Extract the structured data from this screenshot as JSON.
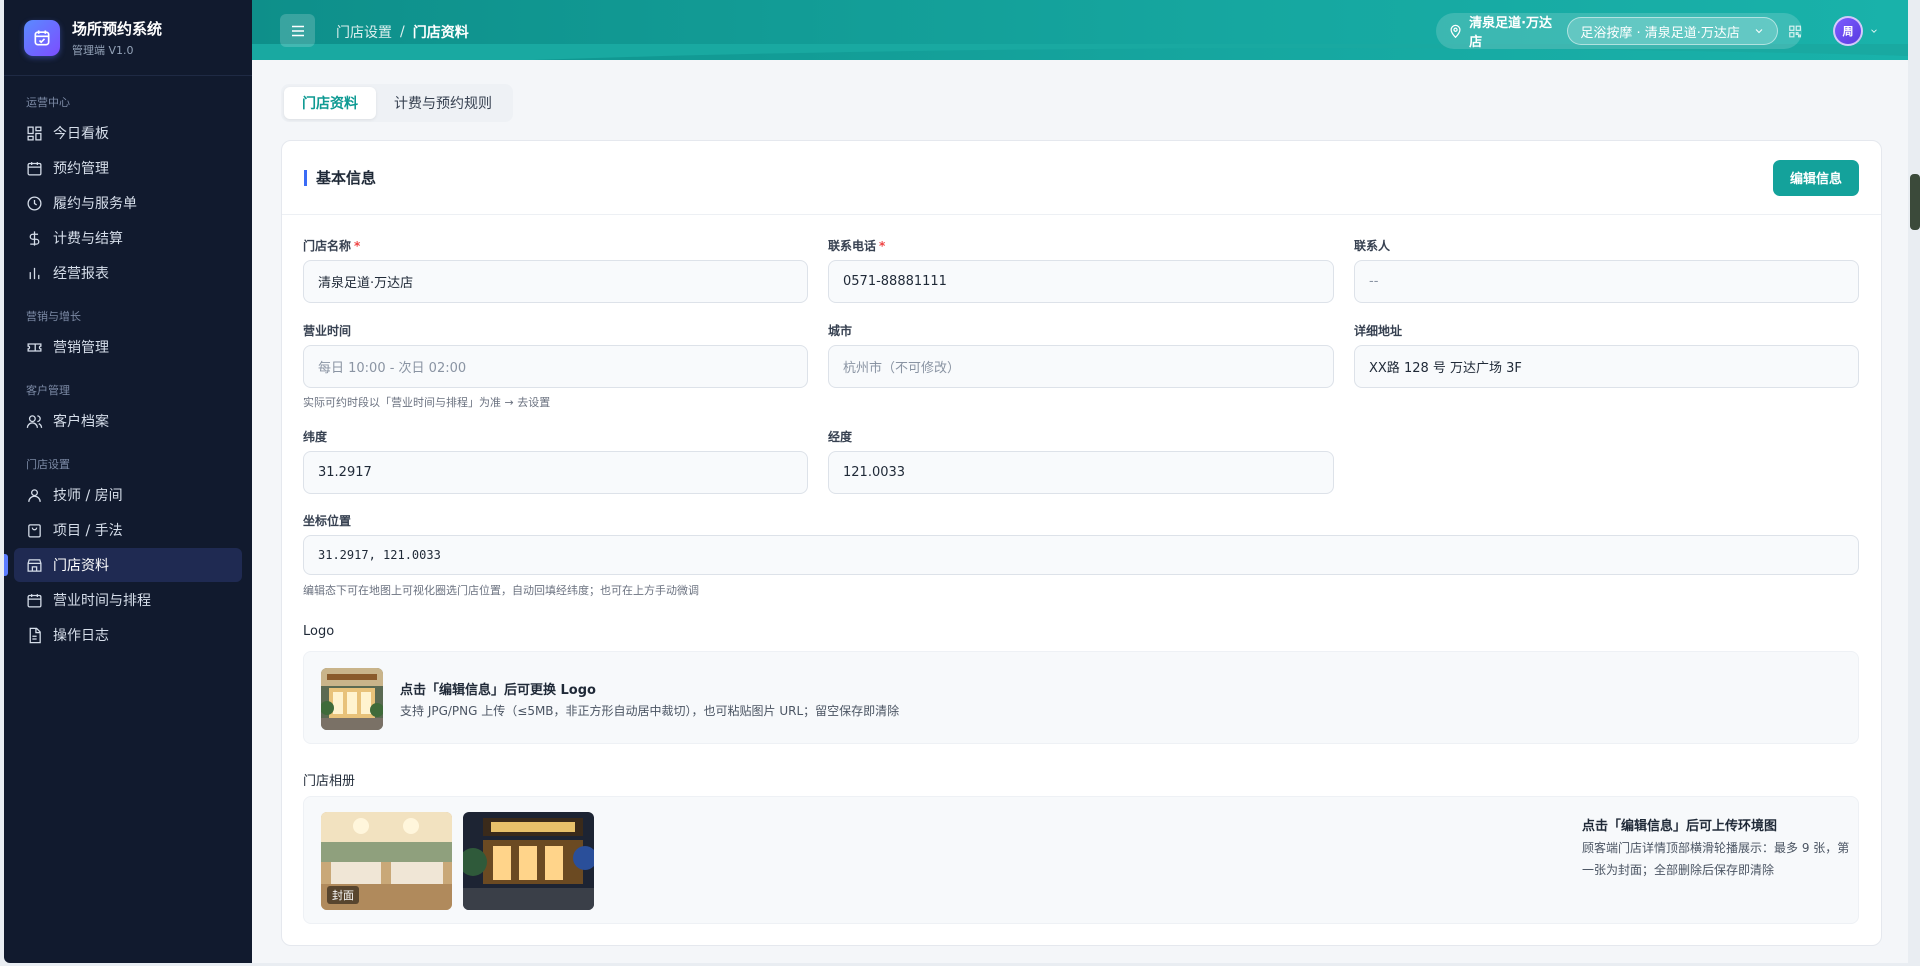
{
  "app": {
    "title": "场所预约系统",
    "version": "管理端 V1.0"
  },
  "sidebar": {
    "groups": [
      {
        "label": "运营中心",
        "items": [
          {
            "label": "今日看板",
            "icon": "dashboard-icon"
          },
          {
            "label": "预约管理",
            "icon": "calendar-icon"
          },
          {
            "label": "履约与服务单",
            "icon": "clock-icon"
          },
          {
            "label": "计费与结算",
            "icon": "dollar-icon"
          },
          {
            "label": "经营报表",
            "icon": "bar-chart-icon"
          }
        ]
      },
      {
        "label": "营销与增长",
        "items": [
          {
            "label": "营销管理",
            "icon": "ticket-icon"
          }
        ]
      },
      {
        "label": "客户管理",
        "items": [
          {
            "label": "客户档案",
            "icon": "users-icon"
          }
        ]
      },
      {
        "label": "门店设置",
        "items": [
          {
            "label": "技师 / 房间",
            "icon": "user-icon"
          },
          {
            "label": "项目 / 手法",
            "icon": "bag-icon"
          },
          {
            "label": "门店资料",
            "icon": "store-icon",
            "active": true
          },
          {
            "label": "营业时间与排程",
            "icon": "calendar-icon"
          },
          {
            "label": "操作日志",
            "icon": "file-icon"
          }
        ]
      }
    ]
  },
  "header": {
    "breadcrumb": [
      "门店设置",
      "门店资料"
    ],
    "store_name": "清泉足道·万达店",
    "store_select": "足浴按摩 · 清泉足道·万达店",
    "avatar": "周"
  },
  "tabs": [
    {
      "label": "门店资料",
      "active": true
    },
    {
      "label": "计费与预约规则",
      "active": false
    }
  ],
  "card": {
    "title": "基本信息",
    "edit_button": "编辑信息",
    "fields": {
      "store_name": {
        "label": "门店名称",
        "required": true,
        "value": "清泉足道·万达店"
      },
      "phone": {
        "label": "联系电话",
        "required": true,
        "value": "0571-88881111"
      },
      "contact": {
        "label": "联系人",
        "value": "--"
      },
      "hours": {
        "label": "营业时间",
        "value": "每日 10:00 - 次日 02:00",
        "hint": "实际可约时段以「营业时间与排程」为准 → 去设置"
      },
      "city": {
        "label": "城市",
        "value": "杭州市（不可修改）"
      },
      "address": {
        "label": "详细地址",
        "value": "XX路 128 号 万达广场 3F"
      },
      "latitude": {
        "label": "纬度",
        "value": "31.2917"
      },
      "longitude": {
        "label": "经度",
        "value": "121.0033"
      },
      "coords": {
        "label": "坐标位置",
        "value": "31.2917, 121.0033",
        "hint": "编辑态下可在地图上可视化圈选门店位置，自动回填经纬度；也可在上方手动微调"
      }
    },
    "logo": {
      "label": "Logo",
      "title": "点击「编辑信息」后可更换 Logo",
      "desc": "支持 JPG/PNG 上传（≤5MB，非正方形自动居中裁切），也可粘贴图片 URL；留空保存即清除"
    },
    "album": {
      "label": "门店相册",
      "cover_tag": "封面",
      "title": "点击「编辑信息」后可上传环境图",
      "desc": "顾客端门店详情顶部横滑轮播展示：最多 9 张，第一张为封面；全部删除后保存即清除"
    }
  }
}
